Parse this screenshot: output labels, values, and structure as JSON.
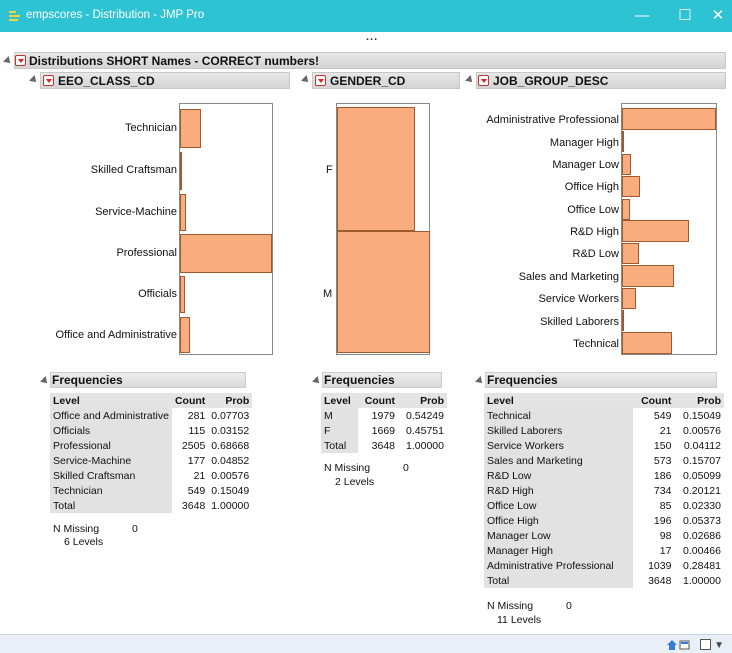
{
  "window": {
    "title": "empscores - Distribution - JMP Pro",
    "minimize": "—",
    "maximize": "☐",
    "close": "✕"
  },
  "more": "...",
  "report": {
    "title": "Distributions SHORT Names - CORRECT numbers!"
  },
  "colors": {
    "titlebar": "#2ec3d3",
    "bar_fill": "#f9ad7f",
    "bar_edge": "#a05a30"
  },
  "panels": {
    "eeo": {
      "title": "EEO_CLASS_CD",
      "labels": [
        "Technician",
        "Skilled Craftsman",
        "Service-Machine",
        "Professional",
        "Officials",
        "Office and Administrative"
      ],
      "freq": {
        "title": "Frequencies",
        "headers": [
          "Level",
          "Count",
          "Prob"
        ],
        "rows": [
          [
            "Office and Administrative",
            "281",
            "0.07703"
          ],
          [
            "Officials",
            "115",
            "0.03152"
          ],
          [
            "Professional",
            "2505",
            "0.68668"
          ],
          [
            "Service-Machine",
            "177",
            "0.04852"
          ],
          [
            "Skilled Craftsman",
            "21",
            "0.00576"
          ],
          [
            "Technician",
            "549",
            "0.15049"
          ],
          [
            "Total",
            "3648",
            "1.00000"
          ]
        ],
        "missing_label": "N Missing",
        "missing_value": "0",
        "levels": "6  Levels"
      }
    },
    "gender": {
      "title": "GENDER_CD",
      "labels": [
        "F",
        "M"
      ],
      "freq": {
        "title": "Frequencies",
        "headers": [
          "Level",
          "Count",
          "Prob"
        ],
        "rows": [
          [
            "M",
            "1979",
            "0.54249"
          ],
          [
            "F",
            "1669",
            "0.45751"
          ],
          [
            "Total",
            "3648",
            "1.00000"
          ]
        ],
        "missing_label": "N Missing",
        "missing_value": "0",
        "levels": "2  Levels"
      }
    },
    "job": {
      "title": "JOB_GROUP_DESC",
      "labels": [
        "Administrative Professional",
        "Manager High",
        "Manager Low",
        "Office High",
        "Office Low",
        "R&D High",
        "R&D Low",
        "Sales and Marketing",
        "Service Workers",
        "Skilled Laborers",
        "Technical"
      ],
      "freq": {
        "title": "Frequencies",
        "headers": [
          "Level",
          "Count",
          "Prob"
        ],
        "rows": [
          [
            "Technical",
            "549",
            "0.15049"
          ],
          [
            "Skilled Laborers",
            "21",
            "0.00576"
          ],
          [
            "Service Workers",
            "150",
            "0.04112"
          ],
          [
            "Sales and Marketing",
            "573",
            "0.15707"
          ],
          [
            "R&D Low",
            "186",
            "0.05099"
          ],
          [
            "R&D High",
            "734",
            "0.20121"
          ],
          [
            "Office Low",
            "85",
            "0.02330"
          ],
          [
            "Office High",
            "196",
            "0.05373"
          ],
          [
            "Manager Low",
            "98",
            "0.02686"
          ],
          [
            "Manager High",
            "17",
            "0.00466"
          ],
          [
            "Administrative Professional",
            "1039",
            "0.28481"
          ],
          [
            "Total",
            "3648",
            "1.00000"
          ]
        ],
        "missing_label": "N Missing",
        "missing_value": "0",
        "levels": "11  Levels"
      }
    }
  }
}
